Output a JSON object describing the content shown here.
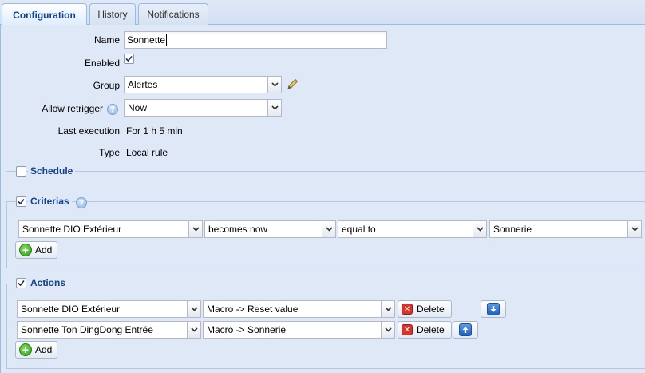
{
  "tabs": [
    {
      "label": "Configuration",
      "active": true
    },
    {
      "label": "History",
      "active": false
    },
    {
      "label": "Notifications",
      "active": false
    }
  ],
  "form": {
    "name_label": "Name",
    "name_value": "Sonnette",
    "enabled_label": "Enabled",
    "enabled_checked": true,
    "group_label": "Group",
    "group_value": "Alertes",
    "retrigger_label": "Allow retrigger",
    "retrigger_value": "Now",
    "last_exec_label": "Last execution",
    "last_exec_value": "For 1 h 5 min",
    "type_label": "Type",
    "type_value": "Local rule"
  },
  "schedule": {
    "legend": "Schedule",
    "checked": false
  },
  "criterias": {
    "legend": "Criterias",
    "checked": true,
    "row": {
      "device": "Sonnette DIO Extérieur",
      "event": "becomes now",
      "operator": "equal to",
      "value": "Sonnerie"
    },
    "add_label": "Add"
  },
  "actions": {
    "legend": "Actions",
    "checked": true,
    "rows": [
      {
        "device": "Sonnette DIO Extérieur",
        "action": "Macro -> Reset value",
        "delete_label": "Delete"
      },
      {
        "device": "Sonnette Ton DingDong Entrée",
        "action": "Macro -> Sonnerie",
        "delete_label": "Delete"
      }
    ],
    "add_label": "Add"
  },
  "colors": {
    "panel_bg": "#dfe8f6",
    "legend_text": "#15428b",
    "tab_border": "#99bbe8"
  }
}
